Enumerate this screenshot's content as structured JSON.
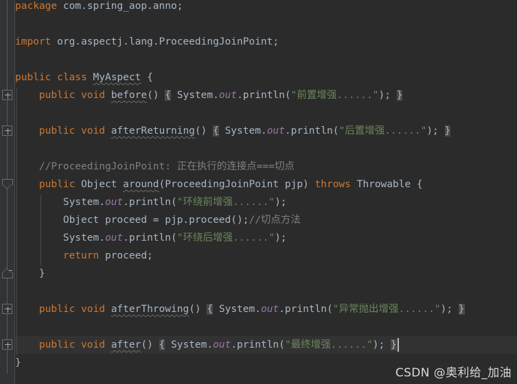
{
  "window": {
    "theme": "darcula",
    "background": "#2b2b2b",
    "gutter_background": "#313335",
    "accent": "#2196A6",
    "current_line_background": "#323232"
  },
  "watermark": {
    "text": "CSDN @奥利给_加油"
  },
  "gutter": {
    "markers": [
      {
        "name": "fold-collapsed-before",
        "type": "plus",
        "line": 5
      },
      {
        "name": "fold-collapsed-afterreturning",
        "type": "plus",
        "line": 7
      },
      {
        "name": "fold-expanded-around-start",
        "type": "arrow-down",
        "line": 10
      },
      {
        "name": "fold-expanded-around-end",
        "type": "arrow-up",
        "line": 15
      },
      {
        "name": "fold-collapsed-afterthrowing",
        "type": "plus",
        "line": 17
      },
      {
        "name": "fold-collapsed-after",
        "type": "plus",
        "line": 19
      }
    ]
  },
  "code": {
    "language": "Java",
    "lines": [
      {
        "n": 1,
        "tokens": [
          {
            "t": "package ",
            "c": "kw"
          },
          {
            "t": "com.spring_aop.anno;",
            "c": "txt"
          }
        ]
      },
      {
        "n": 2,
        "tokens": []
      },
      {
        "n": 3,
        "tokens": [
          {
            "t": "import ",
            "c": "kw"
          },
          {
            "t": "org.aspectj.lang.ProceedingJoinPoint;",
            "c": "txt"
          }
        ]
      },
      {
        "n": 4,
        "tokens": []
      },
      {
        "n": 5,
        "tokens": [
          {
            "t": "public class ",
            "c": "kw"
          },
          {
            "t": "MyAspect",
            "c": "cls wavy"
          },
          {
            "t": " {",
            "c": "txt"
          }
        ]
      },
      {
        "n": 6,
        "tokens": [
          {
            "t": "    ",
            "c": "txt"
          },
          {
            "t": "public void ",
            "c": "kw"
          },
          {
            "t": "before",
            "c": "txt wavy"
          },
          {
            "t": "() ",
            "c": "txt"
          },
          {
            "t": "{",
            "c": "txt brace-box"
          },
          {
            "t": " System.",
            "c": "txt"
          },
          {
            "t": "out",
            "c": "fld"
          },
          {
            "t": ".println(",
            "c": "txt"
          },
          {
            "t": "\"前置增强......\"",
            "c": "str"
          },
          {
            "t": "); ",
            "c": "txt"
          },
          {
            "t": "}",
            "c": "txt brace-box"
          }
        ]
      },
      {
        "n": 7,
        "tokens": []
      },
      {
        "n": 8,
        "tokens": [
          {
            "t": "    ",
            "c": "txt"
          },
          {
            "t": "public void ",
            "c": "kw"
          },
          {
            "t": "afterReturning",
            "c": "txt wavy"
          },
          {
            "t": "() ",
            "c": "txt"
          },
          {
            "t": "{",
            "c": "txt brace-box"
          },
          {
            "t": " System.",
            "c": "txt"
          },
          {
            "t": "out",
            "c": "fld"
          },
          {
            "t": ".println(",
            "c": "txt"
          },
          {
            "t": "\"后置增强......\"",
            "c": "str"
          },
          {
            "t": "); ",
            "c": "txt"
          },
          {
            "t": "}",
            "c": "txt brace-box"
          }
        ]
      },
      {
        "n": 9,
        "tokens": []
      },
      {
        "n": 10,
        "tokens": [
          {
            "t": "    ",
            "c": "txt"
          },
          {
            "t": "//ProceedingJoinPoint: 正在执行的连接点===切点",
            "c": "cmt"
          }
        ]
      },
      {
        "n": 11,
        "tokens": [
          {
            "t": "    ",
            "c": "txt"
          },
          {
            "t": "public ",
            "c": "kw"
          },
          {
            "t": "Object ",
            "c": "txt"
          },
          {
            "t": "around",
            "c": "txt wavy"
          },
          {
            "t": "(ProceedingJoinPoint pjp) ",
            "c": "txt"
          },
          {
            "t": "throws ",
            "c": "kw"
          },
          {
            "t": "Throwable {",
            "c": "txt"
          }
        ]
      },
      {
        "n": 12,
        "tokens": [
          {
            "t": "        System.",
            "c": "txt"
          },
          {
            "t": "out",
            "c": "fld"
          },
          {
            "t": ".println(",
            "c": "txt"
          },
          {
            "t": "\"环绕前增强......\"",
            "c": "str"
          },
          {
            "t": ");",
            "c": "txt"
          }
        ]
      },
      {
        "n": 13,
        "tokens": [
          {
            "t": "        Object proceed = pjp.proceed();",
            "c": "txt"
          },
          {
            "t": "//切点方法",
            "c": "cmt"
          }
        ]
      },
      {
        "n": 14,
        "tokens": [
          {
            "t": "        System.",
            "c": "txt"
          },
          {
            "t": "out",
            "c": "fld"
          },
          {
            "t": ".println(",
            "c": "txt"
          },
          {
            "t": "\"环绕后增强......\"",
            "c": "str"
          },
          {
            "t": ");",
            "c": "txt"
          }
        ]
      },
      {
        "n": 15,
        "tokens": [
          {
            "t": "        ",
            "c": "txt"
          },
          {
            "t": "return ",
            "c": "kw"
          },
          {
            "t": "proceed;",
            "c": "txt"
          }
        ]
      },
      {
        "n": 16,
        "tokens": [
          {
            "t": "    }",
            "c": "txt"
          }
        ]
      },
      {
        "n": 17,
        "tokens": []
      },
      {
        "n": 18,
        "tokens": [
          {
            "t": "    ",
            "c": "txt"
          },
          {
            "t": "public void ",
            "c": "kw"
          },
          {
            "t": "afterThrowing",
            "c": "txt wavy"
          },
          {
            "t": "() ",
            "c": "txt"
          },
          {
            "t": "{",
            "c": "txt brace-box"
          },
          {
            "t": " System.",
            "c": "txt"
          },
          {
            "t": "out",
            "c": "fld"
          },
          {
            "t": ".println(",
            "c": "txt"
          },
          {
            "t": "\"异常抛出增强......\"",
            "c": "str"
          },
          {
            "t": "); ",
            "c": "txt"
          },
          {
            "t": "}",
            "c": "txt brace-box"
          }
        ]
      },
      {
        "n": 19,
        "tokens": []
      },
      {
        "n": 20,
        "current": true,
        "tokens": [
          {
            "t": "    ",
            "c": "txt"
          },
          {
            "t": "public void ",
            "c": "kw"
          },
          {
            "t": "after",
            "c": "txt wavy"
          },
          {
            "t": "() ",
            "c": "txt"
          },
          {
            "t": "{",
            "c": "txt brace-box"
          },
          {
            "t": " System.",
            "c": "txt"
          },
          {
            "t": "out",
            "c": "fld"
          },
          {
            "t": ".println(",
            "c": "txt"
          },
          {
            "t": "\"最终增强......\"",
            "c": "str"
          },
          {
            "t": "); ",
            "c": "txt"
          },
          {
            "t": "}",
            "c": "txt brace-box"
          }
        ]
      },
      {
        "n": 21,
        "tokens": [
          {
            "t": "}",
            "c": "txt"
          }
        ]
      }
    ]
  }
}
